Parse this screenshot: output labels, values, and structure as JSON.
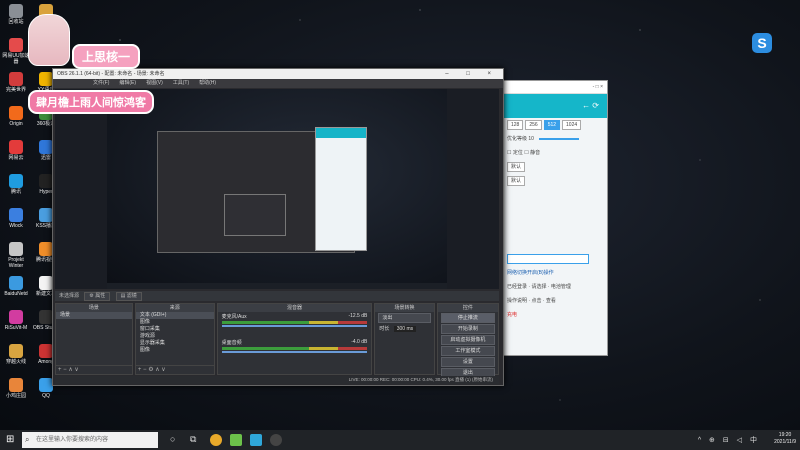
{
  "desktop": {
    "icons": [
      {
        "label": "回收站",
        "color": "#8a8f96"
      },
      {
        "label": "Draw & Guess",
        "color": "#d9a23c"
      },
      {
        "label": "网易UU加速器",
        "color": "#e44b4b"
      },
      {
        "label": "网易音乐",
        "color": "#d43b3b"
      },
      {
        "label": "完美世界",
        "color": "#d23c3c"
      },
      {
        "label": "YY语音",
        "color": "#f0b400"
      },
      {
        "label": "Origin",
        "color": "#f26a1b"
      },
      {
        "label": "360极速",
        "color": "#3b8c3b"
      },
      {
        "label": "网易云",
        "color": "#e33b3b"
      },
      {
        "label": "迅雷",
        "color": "#2f77d9"
      },
      {
        "label": "腾讯",
        "color": "#1f9ce0"
      },
      {
        "label": "Hyper",
        "color": "#222"
      },
      {
        "label": "Wlock",
        "color": "#3b7fe0"
      },
      {
        "label": "KSS播放",
        "color": "#4a9ee0"
      },
      {
        "label": "Projekt Winter",
        "color": "#c6c6c6"
      },
      {
        "label": "腾讯视频",
        "color": "#f08e2a"
      },
      {
        "label": "BaiduNetd",
        "color": "#3b9ae0"
      },
      {
        "label": "新建文本",
        "color": "#f4f4f4"
      },
      {
        "label": "RiSuVit-M",
        "color": "#d23ca0"
      },
      {
        "label": "OBS Studio",
        "color": "#333"
      },
      {
        "label": "穿越火线",
        "color": "#d8a440"
      },
      {
        "label": "Among",
        "color": "#c33"
      },
      {
        "label": "小鸡庄园",
        "color": "#e8853a"
      },
      {
        "label": "QQ",
        "color": "#3aa0ea"
      }
    ]
  },
  "sticker": {
    "title": "上思核一",
    "subtitle": "肆月檐上雨人间惊鸿客"
  },
  "side_app": {
    "top": "- □ ×",
    "tabs": [
      "128",
      "256",
      "512",
      "1024"
    ],
    "selected_tab": "512",
    "row_label": "优化等级 10",
    "check1": "定位",
    "check2": "静音",
    "select1": "默认",
    "select2": "默认",
    "search_placeholder": "",
    "link_text": "网络切换开启(B)操作",
    "line1": "已经登录 · 请选择 · 电池管理",
    "line2": "操作说明 · 点击 · 查看",
    "red_text": "充电"
  },
  "obs": {
    "title": "OBS 26.1.1 (64-bit) - 配置: 未命名 - 场景: 未命名",
    "window_controls": "– □ ×",
    "menus": [
      "文件(F)",
      "编辑(E)",
      "视图(V)",
      "工具(T)",
      "帮助(H)"
    ],
    "toolbar_label": "未选择源",
    "toolbar_btn1": "⚙ 属性",
    "toolbar_btn2": "▤ 滤镜",
    "docks": {
      "scenes": {
        "title": "场景",
        "items": [
          "场景"
        ]
      },
      "sources": {
        "title": "来源",
        "items": [
          "文本 (GDI+)",
          "图像",
          "窗口采集",
          "游戏源",
          "显示器采集",
          "图像"
        ]
      },
      "mixer": {
        "title": "混音器",
        "channels": [
          {
            "name": "麦克风/Aux",
            "db": "-12.5 dB"
          },
          {
            "name": "桌面音频",
            "db": "-4.0 dB"
          }
        ]
      },
      "transitions": {
        "title": "场景转换",
        "type": "淡出",
        "duration_label": "时长",
        "duration": "300 ms"
      },
      "controls": {
        "title": "控件",
        "buttons": [
          "停止推流",
          "开始录制",
          "启动虚拟摄像机",
          "工作室模式",
          "设置",
          "退出"
        ],
        "active": "停止推流"
      }
    },
    "status": "LIVE: 00:00:00   REC: 00:00:00   CPU: 0.4%, 30.00 fps   直播 (1) (原始串流)"
  },
  "taskbar": {
    "search_placeholder": "在这里输入你要搜索的内容",
    "tray": "^ ⊕ ⊟ ◁ 中",
    "time": "19:20",
    "date": "2021/11/9"
  }
}
